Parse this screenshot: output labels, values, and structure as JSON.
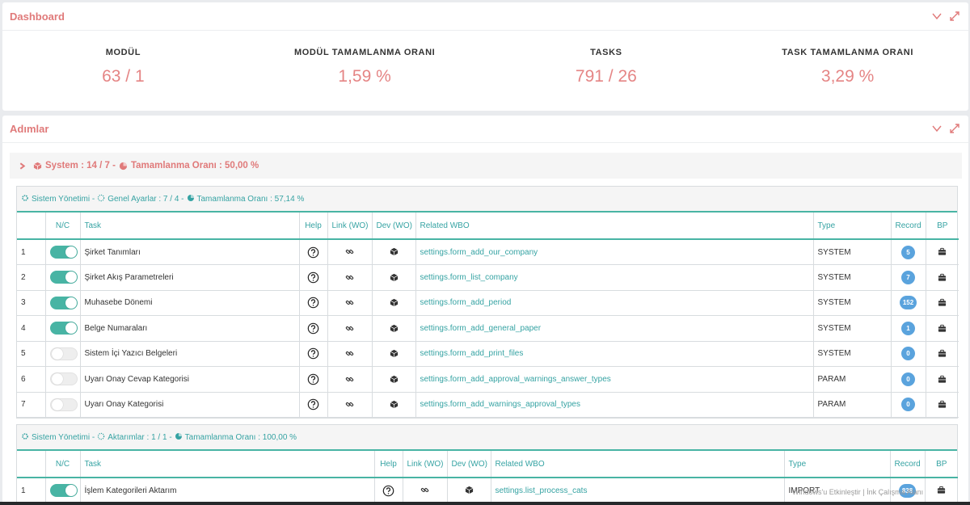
{
  "dashboard": {
    "title": "Dashboard",
    "stats": [
      {
        "label": "MODÜL",
        "value": "63 / 1"
      },
      {
        "label": "MODÜL TAMAMLANMA ORANI",
        "value": "1,59 %"
      },
      {
        "label": "TASKS",
        "value": "791 / 26"
      },
      {
        "label": "TASK TAMAMLANMA ORANI",
        "value": "3,29 %"
      }
    ]
  },
  "steps": {
    "title": "Adımlar",
    "system_prefix": "System : 14 / 7 -",
    "system_rate": "Tamamlanma Oranı : 50,00 %",
    "groups": [
      {
        "head_a": "Sistem Yönetimi -",
        "head_b": "Genel Ayarlar : 7 / 4 -",
        "head_c": "Tamamlanma Oranı : 57,14 %",
        "columns": [
          "N/C",
          "Task",
          "Help",
          "Link (WO)",
          "Dev (WO)",
          "Related WBO",
          "Type",
          "Record",
          "BP"
        ],
        "rows": [
          {
            "no": "1",
            "on": true,
            "task": "Şirket Tanımları",
            "wbo": "settings.form_add_our_company",
            "type": "SYSTEM",
            "record": "5"
          },
          {
            "no": "2",
            "on": true,
            "task": "Şirket Akış Parametreleri",
            "wbo": "settings.form_list_company",
            "type": "SYSTEM",
            "record": "7"
          },
          {
            "no": "3",
            "on": true,
            "task": "Muhasebe Dönemi",
            "wbo": "settings.form_add_period",
            "type": "SYSTEM",
            "record": "152"
          },
          {
            "no": "4",
            "on": true,
            "task": "Belge Numaraları",
            "wbo": "settings.form_add_general_paper",
            "type": "SYSTEM",
            "record": "1"
          },
          {
            "no": "5",
            "on": false,
            "task": "Sistem İçi Yazıcı Belgeleri",
            "wbo": "settings.form_add_print_files",
            "type": "SYSTEM",
            "record": "0"
          },
          {
            "no": "6",
            "on": false,
            "task": "Uyarı Onay Cevap Kategorisi",
            "wbo": "settings.form_add_approval_warnings_answer_types",
            "type": "PARAM",
            "record": "0"
          },
          {
            "no": "7",
            "on": false,
            "task": "Uyarı Onay Kategorisi",
            "wbo": "settings.form_add_warnings_approval_types",
            "type": "PARAM",
            "record": "0"
          }
        ]
      },
      {
        "head_a": "Sistem Yönetimi -",
        "head_b": "Aktarımlar : 1 / 1 -",
        "head_c": "Tamamlanma Oranı : 100,00 %",
        "columns": [
          "N/C",
          "Task",
          "Help",
          "Link (WO)",
          "Dev (WO)",
          "Related WBO",
          "Type",
          "Record",
          "BP"
        ],
        "rows": [
          {
            "no": "1",
            "on": true,
            "task": "İşlem Kategorileri Aktarım",
            "wbo": "settings.list_process_cats",
            "type": "IMPORT",
            "record": "838"
          }
        ]
      }
    ]
  },
  "overlay_text": "Windows'u Etkinleştir | İnk Çalışma Alanı"
}
